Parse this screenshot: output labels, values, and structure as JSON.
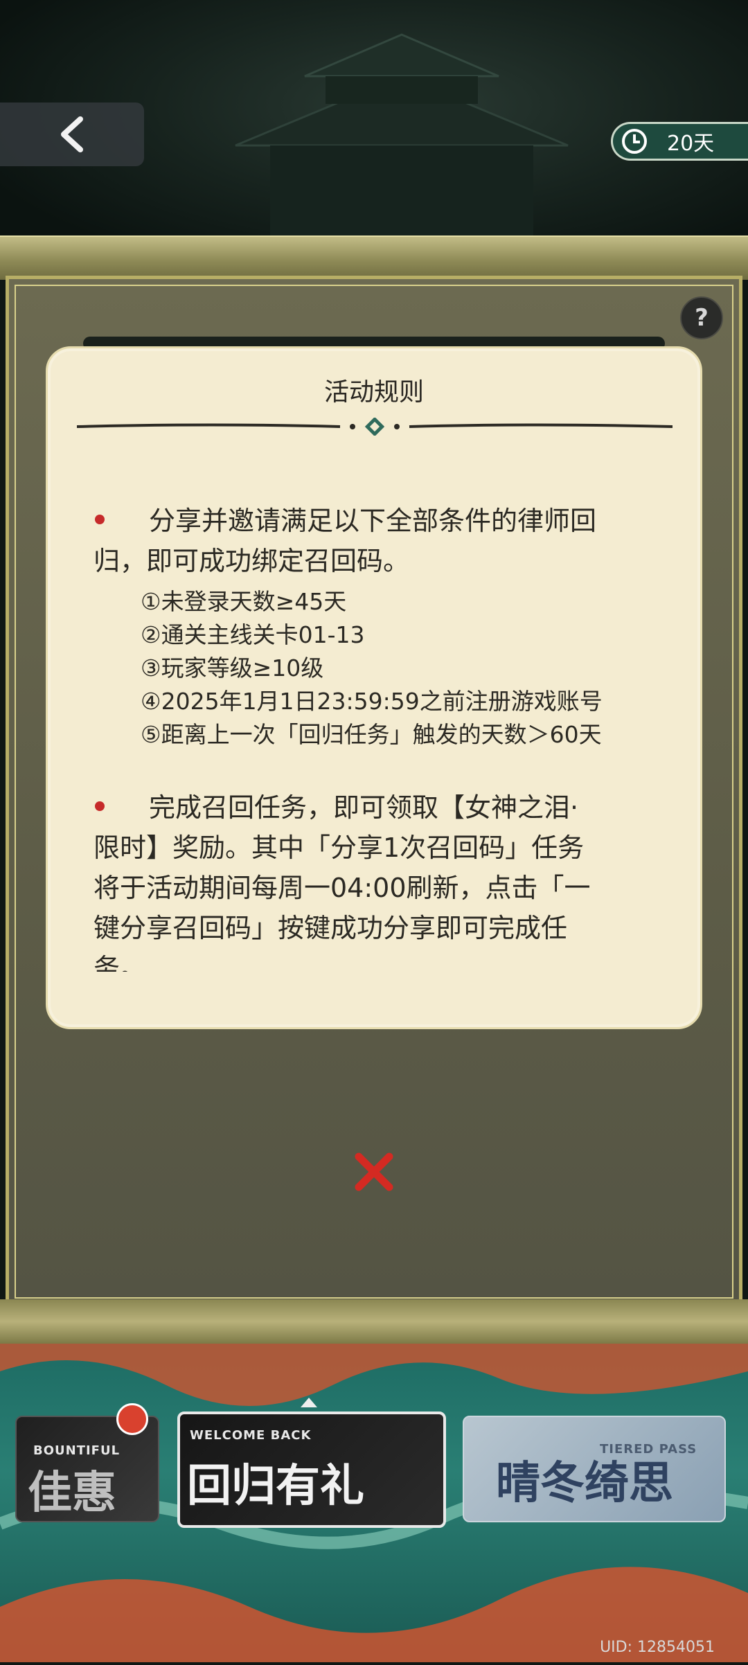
{
  "header": {
    "timer_label": "20天"
  },
  "rules": {
    "title": "活动规则",
    "para1_line1": "分享并邀请满足以下全部条件的律师回",
    "para1_line2": "归，即可成功绑定召回码。",
    "conditions": [
      "①未登录天数≥45天",
      "②通关主线关卡01-13",
      "③玩家等级≥10级",
      "④2025年1月1日23:59:59之前注册游戏账号",
      "⑤距离上一次「回归任务」触发的天数＞60天"
    ],
    "para2_line1": "完成召回任务，即可领取【女神之泪·",
    "para2_line2": "限时】奖励。其中「分享1次召回码」任务",
    "para2_line3": "将于活动期间每周一04:00刷新，点击「一",
    "para2_line4": "键分享召回码」按键成功分享即可完成任",
    "para2_line5": "务。"
  },
  "tabs": {
    "card1_small": "BOUNTIFUL",
    "card1_big": "佳惠",
    "card2_small": "WELCOME BACK",
    "card2_big": "回归有礼",
    "card3_small": "TIERED PASS",
    "card3_big": "晴冬绮思"
  },
  "footer": {
    "uid": "UID: 12854051"
  },
  "colors": {
    "accent_red": "#c62a2a",
    "panel": "#f4ecd1",
    "timer_green": "#1e4a3e"
  }
}
